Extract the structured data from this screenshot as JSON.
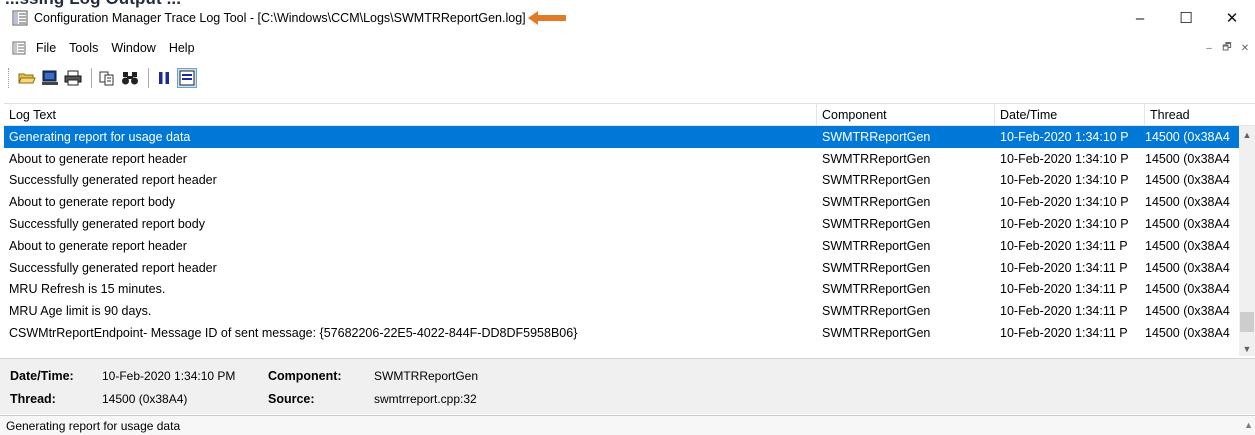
{
  "window": {
    "title": "Configuration Manager Trace Log Tool - [C:\\Windows\\CCM\\Logs\\SWMTRReportGen.log]",
    "minimize": "–",
    "maximize": "☐",
    "close": "✕"
  },
  "heading_fragment": "...ssing Log Output ...",
  "menu": {
    "items": [
      "File",
      "Tools",
      "Window",
      "Help"
    ],
    "mdi": [
      "–",
      "🗗",
      "✕"
    ]
  },
  "toolbar": {
    "buttons": [
      "open-icon",
      "computer-icon",
      "print-icon",
      "copy-icon",
      "find-icon",
      "pause-icon",
      "highlight-icon"
    ]
  },
  "grid": {
    "columns": [
      "Log Text",
      "Component",
      "Date/Time",
      "Thread"
    ],
    "rows": [
      {
        "text": "Generating report for usage data",
        "component": "SWMTRReportGen",
        "datetime": "10-Feb-2020 1:34:10 P",
        "thread": "14500 (0x38A4",
        "selected": true
      },
      {
        "text": "About to generate report header",
        "component": "SWMTRReportGen",
        "datetime": "10-Feb-2020 1:34:10 P",
        "thread": "14500 (0x38A4"
      },
      {
        "text": "Successfully generated report header",
        "component": "SWMTRReportGen",
        "datetime": "10-Feb-2020 1:34:10 P",
        "thread": "14500 (0x38A4"
      },
      {
        "text": "About to generate report body",
        "component": "SWMTRReportGen",
        "datetime": "10-Feb-2020 1:34:10 P",
        "thread": "14500 (0x38A4"
      },
      {
        "text": "Successfully generated report body",
        "component": "SWMTRReportGen",
        "datetime": "10-Feb-2020 1:34:10 P",
        "thread": "14500 (0x38A4"
      },
      {
        "text": "About to generate report header",
        "component": "SWMTRReportGen",
        "datetime": "10-Feb-2020 1:34:11 P",
        "thread": "14500 (0x38A4"
      },
      {
        "text": "Successfully generated report header",
        "component": "SWMTRReportGen",
        "datetime": "10-Feb-2020 1:34:11 P",
        "thread": "14500 (0x38A4"
      },
      {
        "text": "MRU Refresh is 15 minutes.",
        "component": "SWMTRReportGen",
        "datetime": "10-Feb-2020 1:34:11 P",
        "thread": "14500 (0x38A4"
      },
      {
        "text": "MRU Age limit is 90 days.",
        "component": "SWMTRReportGen",
        "datetime": "10-Feb-2020 1:34:11 P",
        "thread": "14500 (0x38A4"
      },
      {
        "text": "CSWMtrReportEndpoint- Message ID of sent message: {57682206-22E5-4022-844F-DD8DF5958B06}",
        "component": "SWMTRReportGen",
        "datetime": "10-Feb-2020 1:34:11 P",
        "thread": "14500 (0x38A4"
      }
    ]
  },
  "details": {
    "datetime_label": "Date/Time:",
    "datetime_value": "10-Feb-2020 1:34:10 PM",
    "component_label": "Component:",
    "component_value": "SWMTRReportGen",
    "thread_label": "Thread:",
    "thread_value": "14500 (0x38A4)",
    "source_label": "Source:",
    "source_value": "swmtrreport.cpp:32"
  },
  "status": {
    "text": "Generating report for usage data"
  },
  "colors": {
    "selection": "#0078d7",
    "arrow": "#e07b28"
  }
}
